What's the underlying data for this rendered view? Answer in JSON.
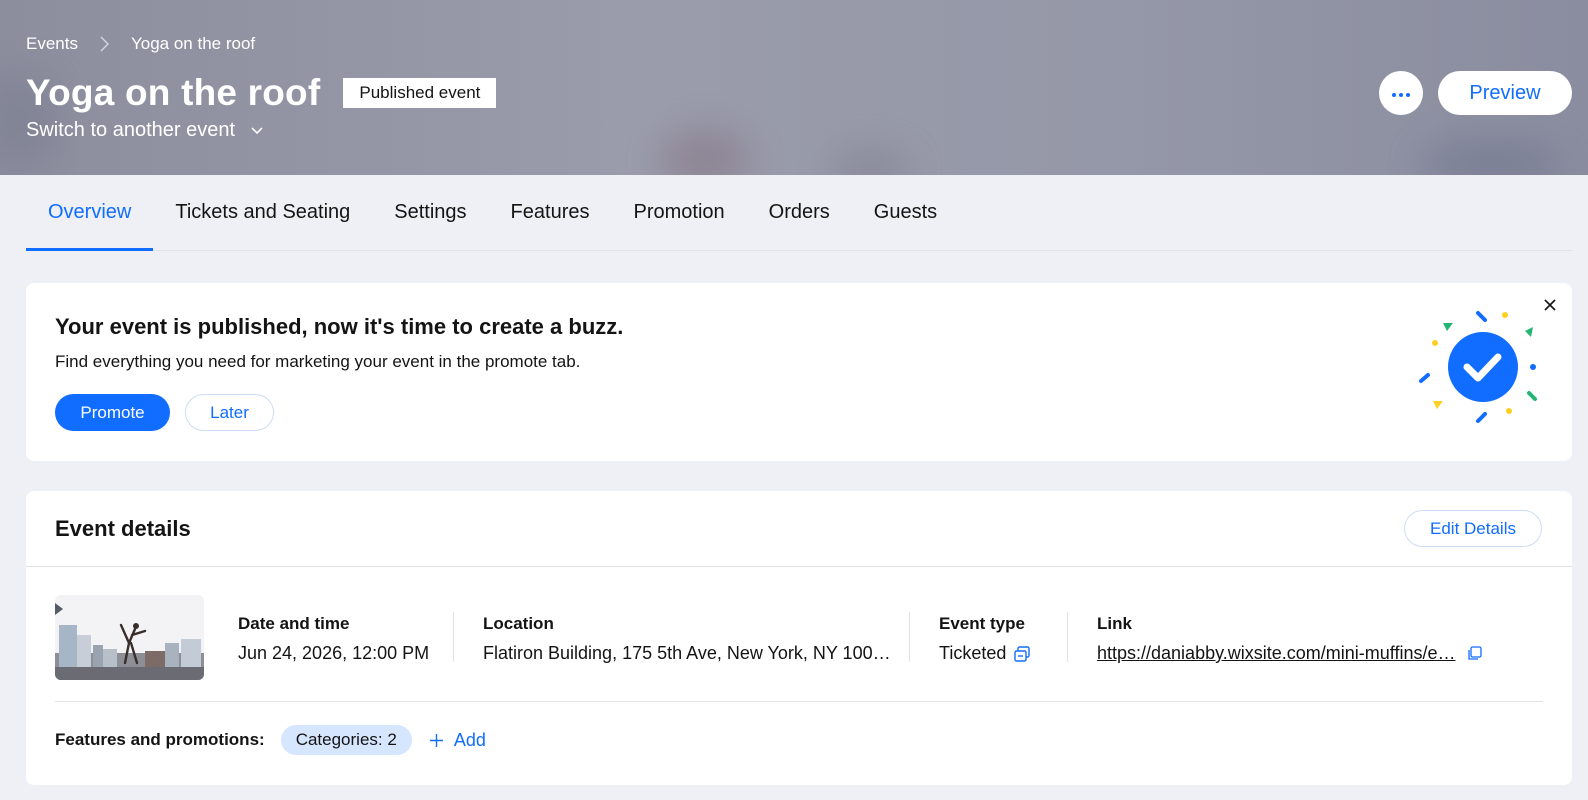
{
  "breadcrumb": {
    "root": "Events",
    "current": "Yoga on the roof"
  },
  "header": {
    "title": "Yoga on the roof",
    "status_badge": "Published event",
    "switch_label": "Switch to another event",
    "preview_label": "Preview",
    "more_icon": "ellipsis-icon"
  },
  "tabs": [
    {
      "label": "Overview",
      "active": true
    },
    {
      "label": "Tickets and Seating",
      "active": false
    },
    {
      "label": "Settings",
      "active": false
    },
    {
      "label": "Features",
      "active": false
    },
    {
      "label": "Promotion",
      "active": false
    },
    {
      "label": "Orders",
      "active": false
    },
    {
      "label": "Guests",
      "active": false
    }
  ],
  "promo": {
    "title": "Your event is published, now it's time to create a buzz.",
    "subtitle": "Find everything you need for marketing your event in the promote tab.",
    "primary_label": "Promote",
    "secondary_label": "Later"
  },
  "details": {
    "title": "Event details",
    "edit_label": "Edit Details",
    "date_label": "Date and time",
    "date_value": "Jun 24, 2026, 12:00 PM",
    "location_label": "Location",
    "location_value": "Flatiron Building, 175 5th Ave, New York, NY 100…",
    "type_label": "Event type",
    "type_value": "Ticketed",
    "link_label": "Link",
    "link_value": "https://daniabby.wixsite.com/mini-muffins/e…",
    "features_label": "Features and promotions:",
    "categories_chip": "Categories: 2",
    "add_label": "Add"
  },
  "colors": {
    "accent": "#116dff",
    "chip_bg": "#d6e6fe",
    "page_bg": "#eef0f5"
  }
}
